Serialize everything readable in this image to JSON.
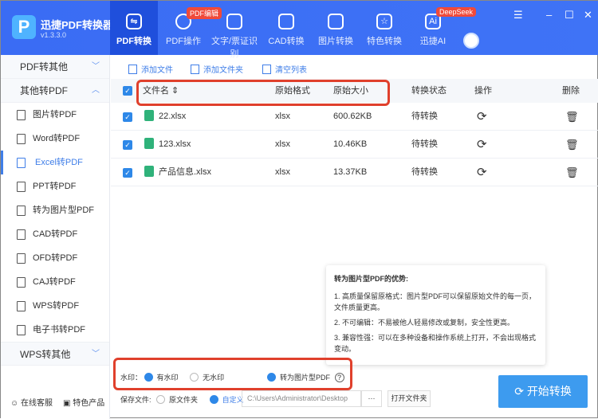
{
  "app": {
    "name": "迅捷PDF转换器",
    "version": "v1.3.3.0",
    "logo_letter": "P"
  },
  "tabs": [
    {
      "label": "PDF转换",
      "icon": "convert-icon"
    },
    {
      "label": "PDF操作",
      "icon": "gear-icon",
      "badge": "PDF编辑"
    },
    {
      "label": "文字/票证识别",
      "icon": "scan-icon"
    },
    {
      "label": "CAD转换",
      "icon": "cad-icon"
    },
    {
      "label": "图片转换",
      "icon": "image-icon"
    },
    {
      "label": "特色转换",
      "icon": "star-icon"
    },
    {
      "label": "迅捷AI",
      "icon": "ai-icon",
      "badge": "DeepSeek"
    }
  ],
  "sidebar": {
    "sections": [
      "PDF转其他",
      "其他转PDF",
      "WPS转其他"
    ],
    "items": [
      "图片转PDF",
      "Word转PDF",
      "Excel转PDF",
      "PPT转PDF",
      "转为图片型PDF",
      "CAD转PDF",
      "OFD转PDF",
      "CAJ转PDF",
      "WPS转PDF",
      "电子书转PDF"
    ],
    "active": "Excel转PDF",
    "footer": [
      "在线客服",
      "特色产品"
    ]
  },
  "toolbar": [
    "添加文件",
    "添加文件夹",
    "清空列表"
  ],
  "table": {
    "headers": [
      "文件名 ⇕",
      "原始格式",
      "原始大小",
      "转换状态",
      "操作",
      "删除"
    ],
    "rows": [
      {
        "name": "22.xlsx",
        "format": "xlsx",
        "size": "600.62KB",
        "status": "待转换"
      },
      {
        "name": "123.xlsx",
        "format": "xlsx",
        "size": "10.46KB",
        "status": "待转换"
      },
      {
        "name": "产品信息.xlsx",
        "format": "xlsx",
        "size": "13.37KB",
        "status": "待转换"
      }
    ]
  },
  "tooltip": {
    "title": "转为图片型PDF的优势:",
    "points": [
      "1. 高质量保留原格式：图片型PDF可以保留原始文件的每一页，文件质量更高。",
      "2. 不可编辑：不易被他人轻易修改或复制，安全性更高。",
      "3. 兼容性强：可以在多种设备和操作系统上打开，不会出现格式变动。"
    ]
  },
  "options": {
    "watermark_label": "水印：",
    "with_watermark": "有水印",
    "no_watermark": "无水印",
    "image_pdf": "转为图片型PDF",
    "help": "?",
    "save_label": "保存文件:",
    "original_folder": "原文件夹",
    "custom": "自定义",
    "path": "C:\\Users\\Administrator\\Desktop",
    "browse": "···",
    "open_folder": "打开文件夹"
  },
  "start_button": "开始转换",
  "colors": {
    "primary": "#3a6cf4",
    "accent": "#2e88e8",
    "highlight": "#e0402c"
  }
}
